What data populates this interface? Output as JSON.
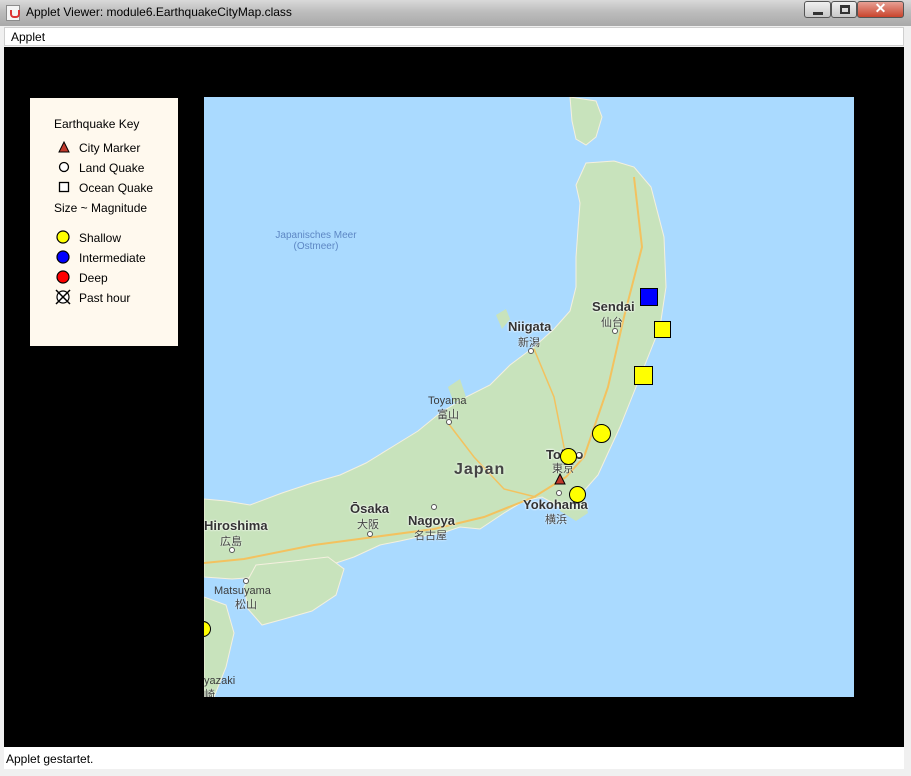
{
  "window": {
    "title": "Applet Viewer: module6.EarthquakeCityMap.class"
  },
  "menu": {
    "applet": "Applet"
  },
  "status": {
    "text": "Applet gestartet."
  },
  "colors": {
    "shallow": "#ffff00",
    "intermediate": "#0000ff",
    "deep": "#ff0000",
    "city": "#c0392b",
    "key_bg": "#fff9ee",
    "water": "#aadaff"
  },
  "key": {
    "title": "Earthquake Key",
    "city_marker": "City Marker",
    "land_quake": "Land Quake",
    "ocean_quake": "Ocean Quake",
    "size": "Size ~ Magnitude",
    "shallow": "Shallow",
    "intermediate": "Intermediate",
    "deep": "Deep",
    "past_hour": "Past hour"
  },
  "map": {
    "sea": "Japanisches Meer\n(Ostmeer)",
    "country": "Japan",
    "cities": {
      "sendai": "Sendai",
      "sendai_jp": "仙台",
      "niigata": "Niigata",
      "niigata_jp": "新潟",
      "toyama": "Toyama",
      "toyama_jp": "富山",
      "tokyo": "Tokyo",
      "tokyo_jp": "東京",
      "yokohama": "Yokohama",
      "yokohama_jp": "横浜",
      "nagoya": "Nagoya",
      "nagoya_jp": "名古屋",
      "osaka": "Ōsaka",
      "osaka_jp": "大阪",
      "hiroshima": "Hiroshima",
      "hiroshima_jp": "広島",
      "matsuyama": "Matsuyama",
      "matsuyama_jp": "松山",
      "miyazaki": "yazaki",
      "miyazaki_jp": "崎"
    }
  }
}
